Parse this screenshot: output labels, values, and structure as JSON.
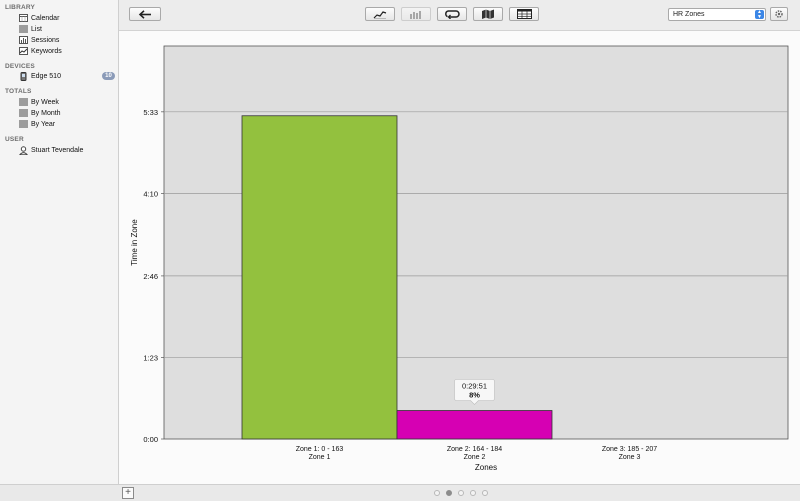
{
  "sidebar": {
    "library": {
      "heading": "LIBRARY",
      "items": [
        {
          "label": "Calendar",
          "icon": "calendar-icon"
        },
        {
          "label": "List",
          "icon": "list-icon"
        },
        {
          "label": "Sessions",
          "icon": "sessions-icon"
        },
        {
          "label": "Keywords",
          "icon": "keywords-icon"
        }
      ]
    },
    "devices": {
      "heading": "DEVICES",
      "items": [
        {
          "label": "Edge 510",
          "icon": "device-icon",
          "badge": "10"
        }
      ]
    },
    "totals": {
      "heading": "TOTALS",
      "items": [
        {
          "label": "By Week",
          "icon": "list-icon"
        },
        {
          "label": "By Month",
          "icon": "list-icon"
        },
        {
          "label": "By Year",
          "icon": "list-icon"
        }
      ]
    },
    "user": {
      "heading": "USER",
      "items": [
        {
          "label": "Stuart Tevendale",
          "icon": "user-icon"
        }
      ]
    }
  },
  "toolbar": {
    "back_icon": "back-arrow-icon",
    "view_buttons": [
      "line-chart-icon",
      "bar-chart-icon",
      "loop-icon",
      "map-icon",
      "table-icon"
    ],
    "select_value": "HR Zones",
    "settings_icon": "gear-icon"
  },
  "pager": {
    "count": 5,
    "active": 1
  },
  "chart_data": {
    "type": "bar",
    "ylabel": "Time in Zone",
    "xlabel": "Zones",
    "y_ticks": [
      "0:00",
      "1:23",
      "2:46",
      "4:10",
      "5:33"
    ],
    "ylim_seconds": [
      0,
      400
    ],
    "categories": [
      {
        "line1": "Zone 1: 0 - 163",
        "line2": "Zone 1",
        "seconds": 329,
        "color": "#93c13e"
      },
      {
        "line1": "Zone 2: 164 - 184",
        "line2": "Zone 2",
        "seconds": 29,
        "color": "#d600b3"
      },
      {
        "line1": "Zone 3: 185 - 207",
        "line2": "Zone 3",
        "seconds": 0,
        "color": "#5a78c9"
      }
    ],
    "tooltip": {
      "category_index": 1,
      "time": "0:29:51",
      "percent": "8%"
    },
    "grid": true,
    "background": "#dedede"
  }
}
